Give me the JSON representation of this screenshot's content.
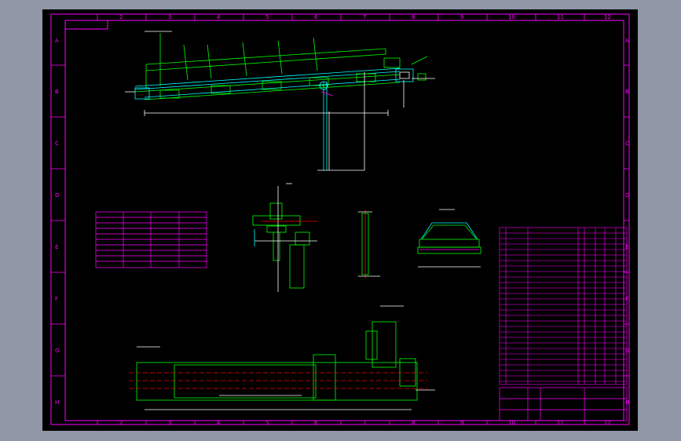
{
  "drawing": {
    "column_labels_top": [
      "2",
      "3",
      "4",
      "5",
      "6",
      "7",
      "8",
      "9",
      "10",
      "11",
      "12"
    ],
    "column_labels_bottom": [
      "2",
      "3",
      "4",
      "5",
      "6",
      "7",
      "8",
      "9",
      "10",
      "11",
      "12"
    ],
    "row_labels_left": [
      "A",
      "B",
      "C",
      "D",
      "E",
      "F",
      "G",
      "H"
    ],
    "row_labels_right": [
      "A",
      "B",
      "C",
      "D",
      "E",
      "F",
      "G",
      "H"
    ]
  },
  "colors": {
    "frame": "#ff00ff",
    "outline": "#00ff00",
    "secondary": "#00ffff",
    "centerline": "#ff0000",
    "dimension": "#ffffff",
    "accent": "#ffff00",
    "background": "#000000",
    "chrome": "#8f97a6"
  },
  "icons": {
    "conveyor_side_view": "conveyor-side-view-drawing",
    "drive_detail": "drive-assembly-detail",
    "column_detail": "support-column-detail",
    "idler_section": "troughing-idler-section",
    "plan_view": "conveyor-plan-view",
    "spec_table": "specification-table",
    "bom_table": "parts-list-table",
    "title_block": "title-block"
  }
}
